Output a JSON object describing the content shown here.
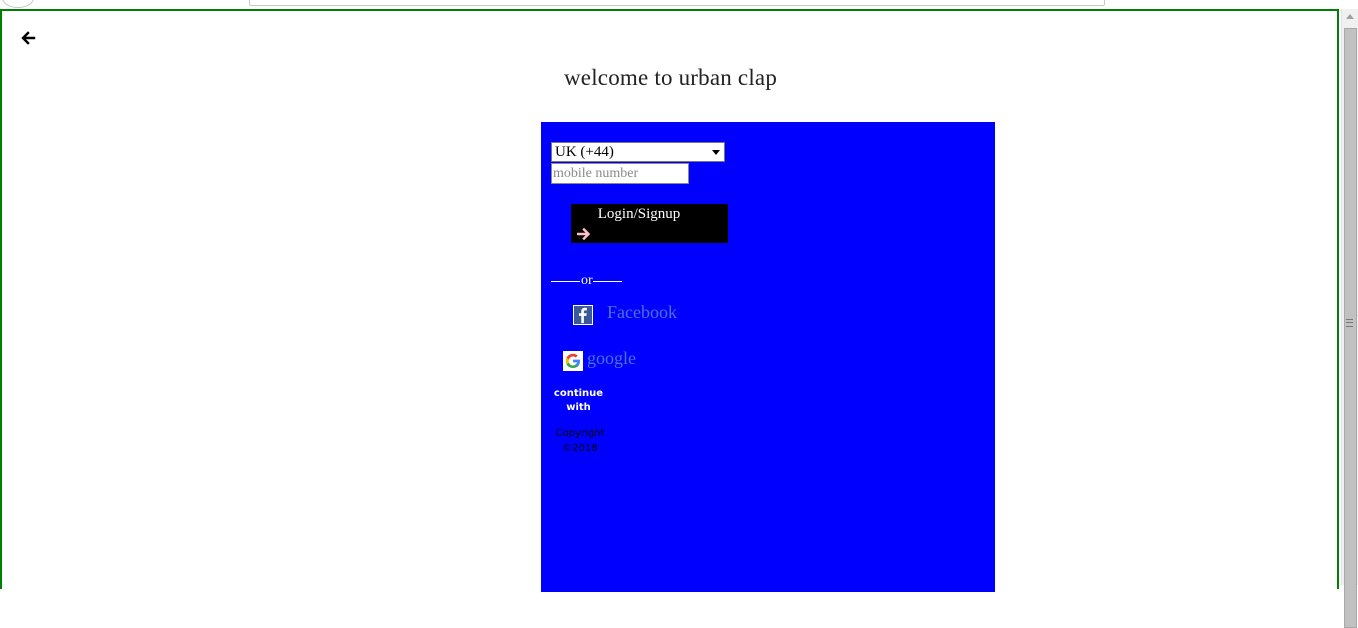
{
  "page": {
    "title": "welcome to urban clap"
  },
  "form": {
    "country_selected": "UK (+44)",
    "mobile_placeholder": "mobile number",
    "mobile_value": "",
    "login_label": "Login/Signup",
    "or_text": "or"
  },
  "social": {
    "facebook_label": "Facebook",
    "google_label": "google",
    "continue_text": "continue with"
  },
  "footer": {
    "copyright_text": "Copyright ©2018"
  },
  "icons": {
    "back": "back-arrow-icon",
    "login_arrow": "arrow-right-icon",
    "facebook": "facebook-icon",
    "google": "google-icon"
  },
  "colors": {
    "panel_bg": "#0000ff",
    "frame_border": "#008000",
    "login_bg": "#000000",
    "social_text": "#4f6fdc"
  }
}
